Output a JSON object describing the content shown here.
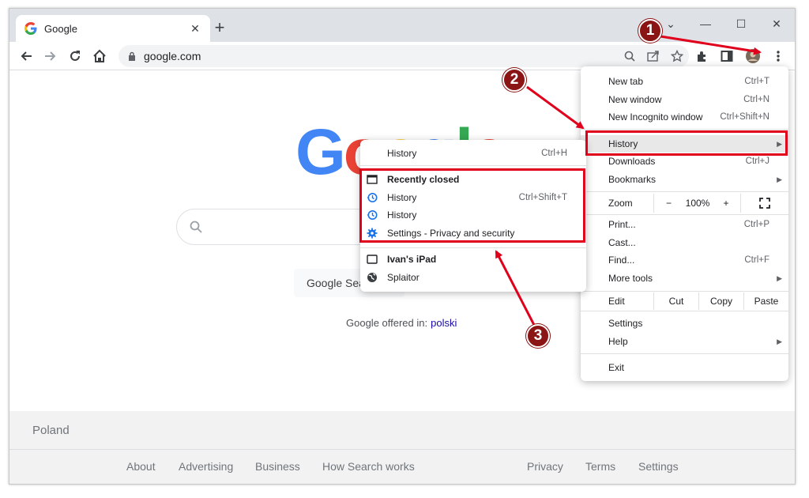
{
  "browser": {
    "tab_title": "Google",
    "tab_close": "✕",
    "new_tab": "+",
    "window_controls": {
      "collapse": "⌄",
      "minimize": "—",
      "maximize": "☐",
      "close": "✕"
    },
    "url": "google.com"
  },
  "page": {
    "logo_letters": [
      "G",
      "o",
      "o",
      "g",
      "l",
      "e"
    ],
    "logo_colors": [
      "#4285f4",
      "#ea4335",
      "#fbbc05",
      "#4285f4",
      "#34a853",
      "#ea4335"
    ],
    "search_button": "Google Sea",
    "offered_in": "Google offered in:",
    "language_link": "polski",
    "country": "Poland",
    "footer_links": [
      "About",
      "Advertising",
      "Business",
      "How Search works",
      "Privacy",
      "Terms",
      "Settings"
    ]
  },
  "menu": {
    "new_tab": {
      "label": "New tab",
      "shortcut": "Ctrl+T"
    },
    "new_window": {
      "label": "New window",
      "shortcut": "Ctrl+N"
    },
    "new_incognito": {
      "label": "New Incognito window",
      "shortcut": "Ctrl+Shift+N"
    },
    "history": {
      "label": "History"
    },
    "downloads": {
      "label": "Downloads",
      "shortcut": "Ctrl+J"
    },
    "bookmarks": {
      "label": "Bookmarks"
    },
    "zoom": {
      "label": "Zoom",
      "minus": "−",
      "level": "100%",
      "plus": "+"
    },
    "print": {
      "label": "Print...",
      "shortcut": "Ctrl+P"
    },
    "cast": {
      "label": "Cast..."
    },
    "find": {
      "label": "Find...",
      "shortcut": "Ctrl+F"
    },
    "more_tools": {
      "label": "More tools"
    },
    "edit": {
      "label": "Edit",
      "cut": "Cut",
      "copy": "Copy",
      "paste": "Paste"
    },
    "settings": {
      "label": "Settings"
    },
    "help": {
      "label": "Help"
    },
    "exit": {
      "label": "Exit"
    },
    "submenu_arrow": "▶"
  },
  "submenu": {
    "history": {
      "label": "History",
      "shortcut": "Ctrl+H"
    },
    "recently_closed": "Recently closed",
    "items": [
      {
        "label": "History",
        "shortcut": "Ctrl+Shift+T"
      },
      {
        "label": "History",
        "shortcut": ""
      },
      {
        "label": "Settings - Privacy and security",
        "shortcut": ""
      }
    ],
    "device": "Ivan's iPad",
    "device_tab": "Splaitor"
  },
  "annotations": {
    "step1": "1",
    "step2": "2",
    "step3": "3",
    "color": "#e0001b"
  }
}
